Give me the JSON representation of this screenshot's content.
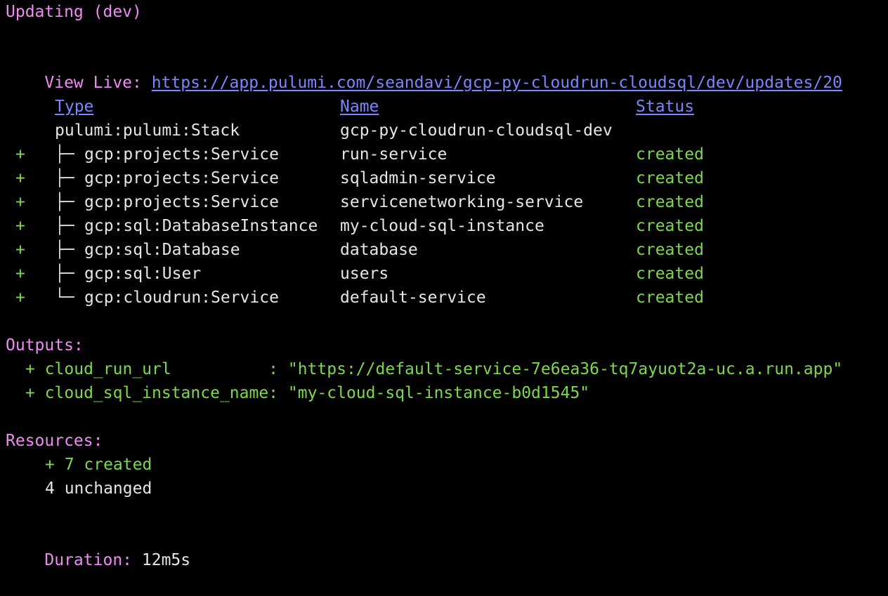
{
  "header": {
    "updating": "Updating (dev)",
    "view_live_label": "View Live:",
    "view_live_url": "https://app.pulumi.com/seandavi/gcp-py-cloudrun-cloudsql/dev/updates/20"
  },
  "table": {
    "headers": {
      "type": "Type",
      "name": "Name",
      "status": "Status"
    },
    "stack": {
      "type": "pulumi:pulumi:Stack",
      "name": "gcp-py-cloudrun-cloudsql-dev"
    },
    "rows": [
      {
        "op": "+",
        "tree": "├─",
        "type": "gcp:projects:Service",
        "name": "run-service",
        "status": "created"
      },
      {
        "op": "+",
        "tree": "├─",
        "type": "gcp:projects:Service",
        "name": "sqladmin-service",
        "status": "created"
      },
      {
        "op": "+",
        "tree": "├─",
        "type": "gcp:projects:Service",
        "name": "servicenetworking-service",
        "status": "created"
      },
      {
        "op": "+",
        "tree": "├─",
        "type": "gcp:sql:DatabaseInstance",
        "name": "my-cloud-sql-instance",
        "status": "created"
      },
      {
        "op": "+",
        "tree": "├─",
        "type": "gcp:sql:Database",
        "name": "database",
        "status": "created"
      },
      {
        "op": "+",
        "tree": "├─",
        "type": "gcp:sql:User",
        "name": "users",
        "status": "created"
      },
      {
        "op": "+",
        "tree": "└─",
        "type": "gcp:cloudrun:Service",
        "name": "default-service",
        "status": "created"
      }
    ]
  },
  "outputs": {
    "label": "Outputs:",
    "items": [
      {
        "text": "+ cloud_run_url          : \"https://default-service-7e6ea36-tq7ayuot2a-uc.a.run.app\""
      },
      {
        "text": "+ cloud_sql_instance_name: \"my-cloud-sql-instance-b0d1545\""
      }
    ]
  },
  "resources": {
    "label": "Resources:",
    "created": "+ 7 created",
    "unchanged": "4 unchanged"
  },
  "duration": {
    "label": "Duration:",
    "value": "12m5s"
  },
  "colors": {
    "background": "#000000",
    "magenta": "#f08bf6",
    "green": "#7dd94a",
    "link": "#7b86ff",
    "text": "#e6e6e6"
  }
}
